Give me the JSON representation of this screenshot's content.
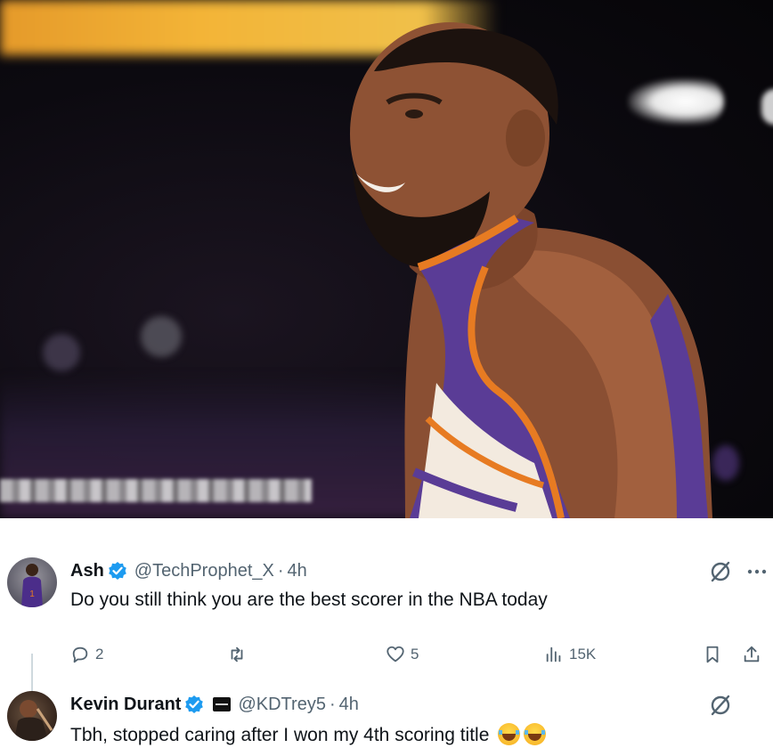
{
  "thread": {
    "tweets": [
      {
        "name": "Ash",
        "verified": true,
        "handle": "@TechProphet_X",
        "separator": "·",
        "time": "4h",
        "text": "Do you still think you are the best scorer in the NBA today",
        "actions": {
          "replies": "2",
          "reposts": "",
          "likes": "5",
          "views": "15K"
        }
      },
      {
        "name": "Kevin Durant",
        "verified": true,
        "affiliation_badge": true,
        "handle": "@KDTrey5",
        "separator": "·",
        "time": "4h",
        "text": "Tbh, stopped caring after I won my 4th scoring title",
        "emoji": [
          "laughing-tears-emoji",
          "laughing-tears-emoji"
        ]
      }
    ]
  },
  "icons": {
    "verified": "verified-badge-icon",
    "grok": "grok-icon",
    "more": "more-icon",
    "reply": "reply-icon",
    "repost": "repost-icon",
    "like": "like-icon",
    "views": "views-icon",
    "bookmark": "bookmark-icon",
    "share": "share-icon"
  },
  "colors": {
    "verified_blue": "#1d9bf0",
    "text_primary": "#0f1419",
    "text_secondary": "#536471",
    "jersey_purple": "#5a3c96",
    "jersey_orange": "#e77b22"
  }
}
